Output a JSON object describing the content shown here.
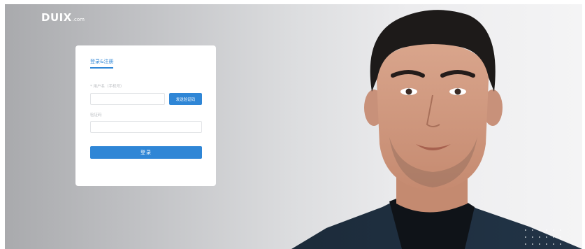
{
  "brand": {
    "logo_text": "DUIX",
    "logo_suffix": ".com"
  },
  "login_card": {
    "tab_label": "登录&注册",
    "phone_label": "* 用户名（手机号）",
    "phone_value": "",
    "sms_button_label": "发送验证码",
    "code_label": "验证码",
    "code_value": "",
    "login_button_label": "登录"
  },
  "colors": {
    "accent": "#2f86d6",
    "label_gray": "#b9bcc0"
  },
  "icons": {
    "portrait": "person-portrait-image"
  }
}
